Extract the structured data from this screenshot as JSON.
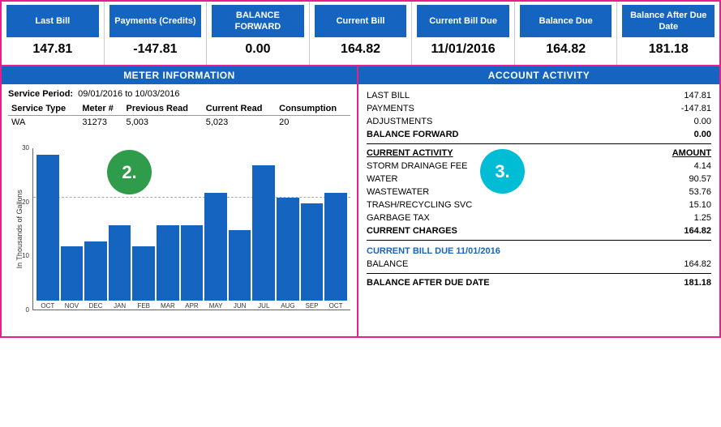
{
  "summary": {
    "cells": [
      {
        "label": "Last Bill",
        "value": "147.81"
      },
      {
        "label": "Payments\n(Credits)",
        "value": "-147.81"
      },
      {
        "label": "BALANCE\nFORWARD",
        "value": "0.00"
      },
      {
        "label": "Current Bill",
        "value": "164.82"
      },
      {
        "label": "Current\nBill Due",
        "value": "11/01/2016"
      },
      {
        "label": "Balance Due",
        "value": "164.82"
      },
      {
        "label": "Balance After\nDue Date",
        "value": "181.18"
      }
    ]
  },
  "meterInfo": {
    "title": "METER INFORMATION",
    "servicePeriodLabel": "Service Period:",
    "servicePeriodValue": "09/01/2016 to 10/03/2016",
    "tableHeaders": [
      "Service Type",
      "Meter #",
      "Previous Read",
      "Current Read",
      "Consumption"
    ],
    "tableRows": [
      [
        "WA",
        "31273",
        "5,003",
        "5,023",
        "20"
      ]
    ]
  },
  "chart": {
    "yAxisLabel": "In Thousands of Gallons",
    "yTicks": [
      "0",
      "10",
      "20",
      "30"
    ],
    "dashed_y": 21,
    "bars": [
      {
        "label": "OCT",
        "value": 27
      },
      {
        "label": "NOV",
        "value": 10
      },
      {
        "label": "DEC",
        "value": 11
      },
      {
        "label": "JAN",
        "value": 14
      },
      {
        "label": "FEB",
        "value": 10
      },
      {
        "label": "MAR",
        "value": 14
      },
      {
        "label": "APR",
        "value": 14
      },
      {
        "label": "MAY",
        "value": 20
      },
      {
        "label": "JUN",
        "value": 13
      },
      {
        "label": "JUL",
        "value": 25
      },
      {
        "label": "AUG",
        "value": 19
      },
      {
        "label": "SEP",
        "value": 18
      },
      {
        "label": "OCT",
        "value": 20
      }
    ],
    "maxValue": 30
  },
  "accountActivity": {
    "title": "ACCOUNT ACTIVITY",
    "items": [
      {
        "label": "LAST BILL",
        "value": "147.81",
        "bold": false,
        "underline": false
      },
      {
        "label": "PAYMENTS",
        "value": "-147.81",
        "bold": false,
        "underline": false
      },
      {
        "label": "ADJUSTMENTS",
        "value": "0.00",
        "bold": false,
        "underline": false
      },
      {
        "label": "BALANCE FORWARD",
        "value": "0.00",
        "bold": true,
        "underline": false
      }
    ],
    "currentActivityLabel": "CURRENT ACTIVITY",
    "currentActivityAmountLabel": "AMOUNT",
    "currentItems": [
      {
        "label": "STORM DRAINAGE FEE",
        "value": "4.14"
      },
      {
        "label": "WATER",
        "value": "90.57"
      },
      {
        "label": "WASTEWATER",
        "value": "53.76"
      },
      {
        "label": "TRASH/RECYCLING SVC",
        "value": "15.10"
      },
      {
        "label": "GARBAGE TAX",
        "value": "1.25"
      }
    ],
    "currentChargesLabel": "CURRENT CHARGES",
    "currentChargesValue": "164.82",
    "billDueLabel": "CURRENT BILL DUE 11/01/2016",
    "balanceLabel": "BALANCE",
    "balanceValue": "164.82",
    "balanceAfterLabel": "BALANCE AFTER DUE DATE",
    "balanceAfterValue": "181.18"
  },
  "badges": {
    "badge2": {
      "label": "2.",
      "color": "#2e9c4a"
    },
    "badge3": {
      "label": "3.",
      "color": "#00bcd4"
    }
  }
}
